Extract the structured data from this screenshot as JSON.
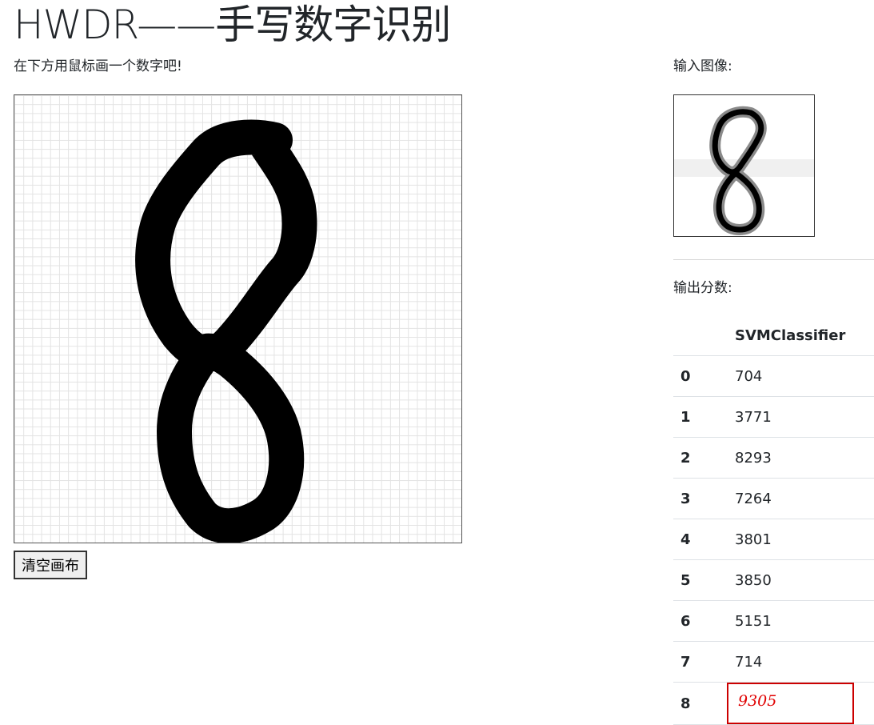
{
  "header": {
    "title": "HWDR——手写数字识别"
  },
  "canvas_panel": {
    "instruction": "在下方用鼠标画一个数字吧!",
    "clear_button_label": "清空画布"
  },
  "right_panel": {
    "input_label": "输入图像:",
    "output_label": "输出分数:",
    "table": {
      "column_header": "SVMClassifier",
      "rows": [
        {
          "digit": "0",
          "score": "704"
        },
        {
          "digit": "1",
          "score": "3771"
        },
        {
          "digit": "2",
          "score": "8293"
        },
        {
          "digit": "3",
          "score": "7264"
        },
        {
          "digit": "4",
          "score": "3801"
        },
        {
          "digit": "5",
          "score": "3850"
        },
        {
          "digit": "6",
          "score": "5151"
        },
        {
          "digit": "7",
          "score": "714"
        },
        {
          "digit": "8",
          "score": "9305"
        }
      ],
      "highlight_digit": "8"
    }
  },
  "colors": {
    "highlight": "#cc0000",
    "stroke": "#000000",
    "grid": "#e3e3e3"
  }
}
